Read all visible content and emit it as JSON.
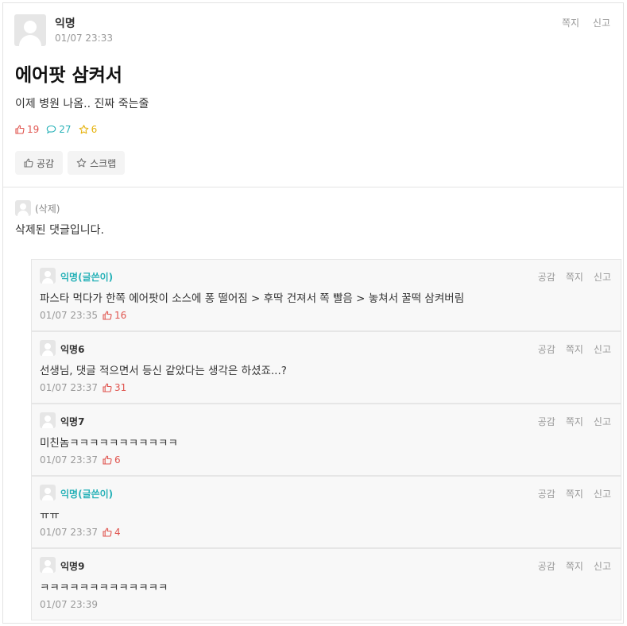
{
  "post": {
    "author": "익명",
    "time": "01/07 23:33",
    "actions": {
      "message": "쪽지",
      "report": "신고"
    },
    "title": "에어팟 삼켜서",
    "content": "이제 병원 나옴.. 진짜 죽는줄",
    "stats": {
      "likes": "19",
      "comments": "27",
      "scraps": "6"
    },
    "buttons": {
      "like": "공감",
      "scrap": "스크랩"
    }
  },
  "deleted_comment": {
    "author": "(삭제)",
    "text": "삭제된 댓글입니다."
  },
  "replies": [
    {
      "author": "익명(글쓴이)",
      "is_op": true,
      "text": "파스타 먹다가 한쪽 에어팟이 소스에 퐁 떨어짐 > 후딱 건져서 쪽 빨음 > 놓쳐서 꿀떡 삼켜버림",
      "time": "01/07 23:35",
      "likes": "16"
    },
    {
      "author": "익명6",
      "is_op": false,
      "text": "선생님, 댓글 적으면서 등신 같았다는 생각은 하셨죠...?",
      "time": "01/07 23:37",
      "likes": "31"
    },
    {
      "author": "익명7",
      "is_op": false,
      "text": "미친놈ㅋㅋㅋㅋㅋㅋㅋㅋㅋㅋㅋ",
      "time": "01/07 23:37",
      "likes": "6"
    },
    {
      "author": "익명(글쓴이)",
      "is_op": true,
      "text": "ㅠㅠ",
      "time": "01/07 23:37",
      "likes": "4"
    },
    {
      "author": "익명9",
      "is_op": false,
      "text": "ㅋㅋㅋㅋㅋㅋㅋㅋㅋㅋㅋㅋㅋ",
      "time": "01/07 23:39",
      "likes": ""
    }
  ],
  "reply_actions": {
    "like": "공감",
    "message": "쪽지",
    "report": "신고"
  },
  "colors": {
    "accent_teal": "#29b2b8",
    "like_red": "#e0554f",
    "scrap_yellow": "#e6b20c"
  }
}
